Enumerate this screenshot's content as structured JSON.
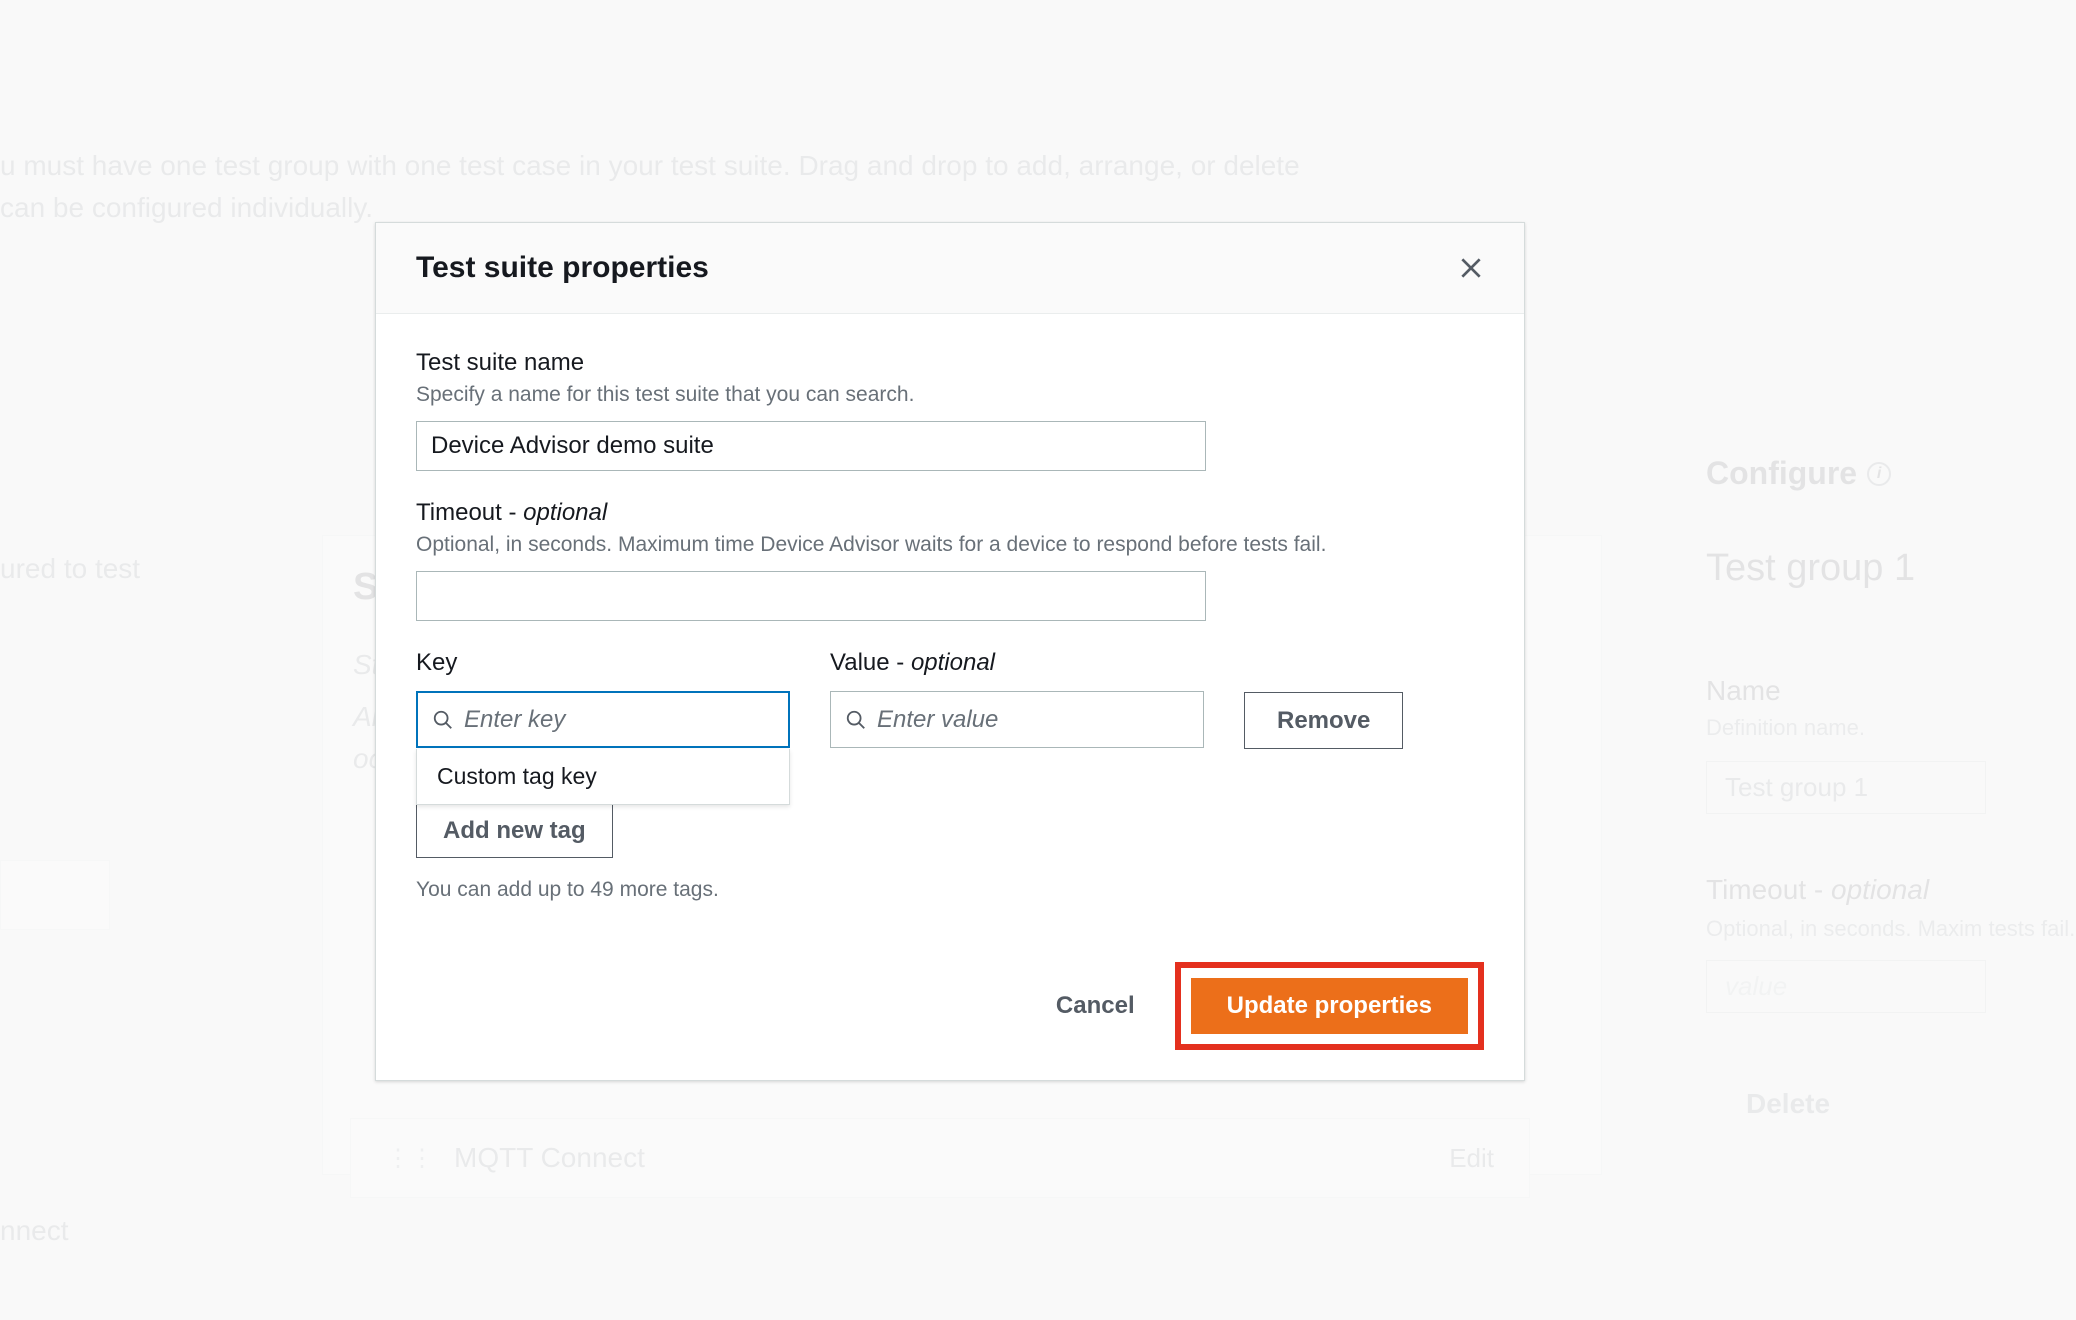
{
  "background": {
    "top_text_line1": "u must have one test group with one test case in your test suite. Drag and drop to add, arrange, or delete",
    "top_text_line2": "can be configured individually.",
    "configured_text": "ured to test",
    "connect_text": "nnect",
    "st_panel": {
      "header": "St",
      "italic1": "Sta",
      "italic2": "All",
      "italic3": "occ"
    },
    "mqtt": {
      "label": "MQTT Connect",
      "edit": "Edit"
    },
    "right": {
      "configure": "Configure",
      "group_title": "Test group 1",
      "name_label": "Name",
      "name_desc": "Definition name.",
      "name_value": "Test group 1",
      "timeout_label": "Timeout - ",
      "timeout_optional": "optional",
      "timeout_desc": "Optional, in seconds. Maxim tests fail.",
      "timeout_placeholder": "value",
      "delete": "Delete"
    }
  },
  "modal": {
    "title": "Test suite properties",
    "suite_name": {
      "label": "Test suite name",
      "description": "Specify a name for this test suite that you can search.",
      "value": "Device Advisor demo suite"
    },
    "timeout": {
      "label": "Timeout - ",
      "optional": "optional",
      "description": "Optional, in seconds. Maximum time Device Advisor waits for a device to respond before tests fail.",
      "value": ""
    },
    "tags": {
      "key_label": "Key",
      "value_label": "Value - ",
      "value_optional": "optional",
      "key_placeholder": "Enter key",
      "value_placeholder": "Enter value",
      "remove_label": "Remove",
      "autocomplete_option": "Custom tag key",
      "add_label": "Add new tag",
      "count_note": "You can add up to 49 more tags."
    },
    "footer": {
      "cancel": "Cancel",
      "update": "Update properties"
    }
  }
}
